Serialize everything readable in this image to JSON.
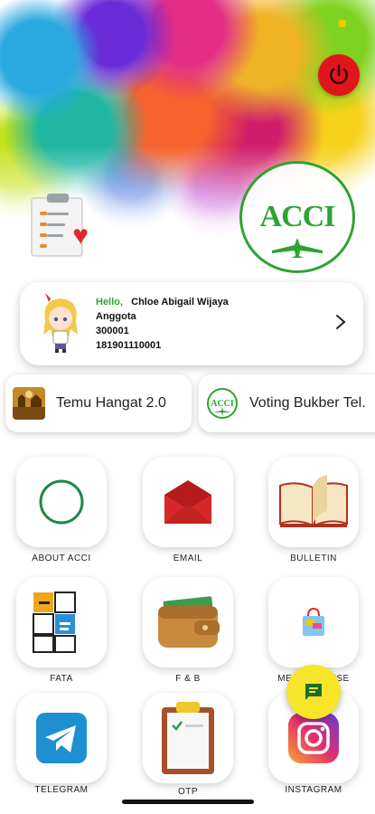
{
  "profile": {
    "greeting": "Hello,",
    "name": "Chloe Abigail Wijaya",
    "role": "Anggota",
    "member_code": "300001",
    "member_number": "181901110001"
  },
  "logo": {
    "text": "ACCI"
  },
  "quick_links": [
    {
      "label": "Temu Hangat 2.0"
    },
    {
      "label": "Voting Bukber Tel."
    }
  ],
  "menu": [
    {
      "label": "ABOUT ACCI",
      "icon": "circle-icon"
    },
    {
      "label": "EMAIL",
      "icon": "envelope-icon"
    },
    {
      "label": "BULLETIN",
      "icon": "book-icon"
    },
    {
      "label": "FATA",
      "icon": "fata-icon"
    },
    {
      "label": "F & B",
      "icon": "wallet-icon"
    },
    {
      "label": "MERCHANDISE",
      "icon": "shopping-bag-icon"
    },
    {
      "label": "TELEGRAM",
      "icon": "telegram-icon"
    },
    {
      "label": "OTP",
      "icon": "clipboard-check-icon"
    },
    {
      "label": "INSTAGRAM",
      "icon": "instagram-icon"
    }
  ],
  "colors": {
    "accent_green": "#2fa331",
    "power_red": "#e0161d",
    "fab_yellow": "#f7e52a"
  }
}
